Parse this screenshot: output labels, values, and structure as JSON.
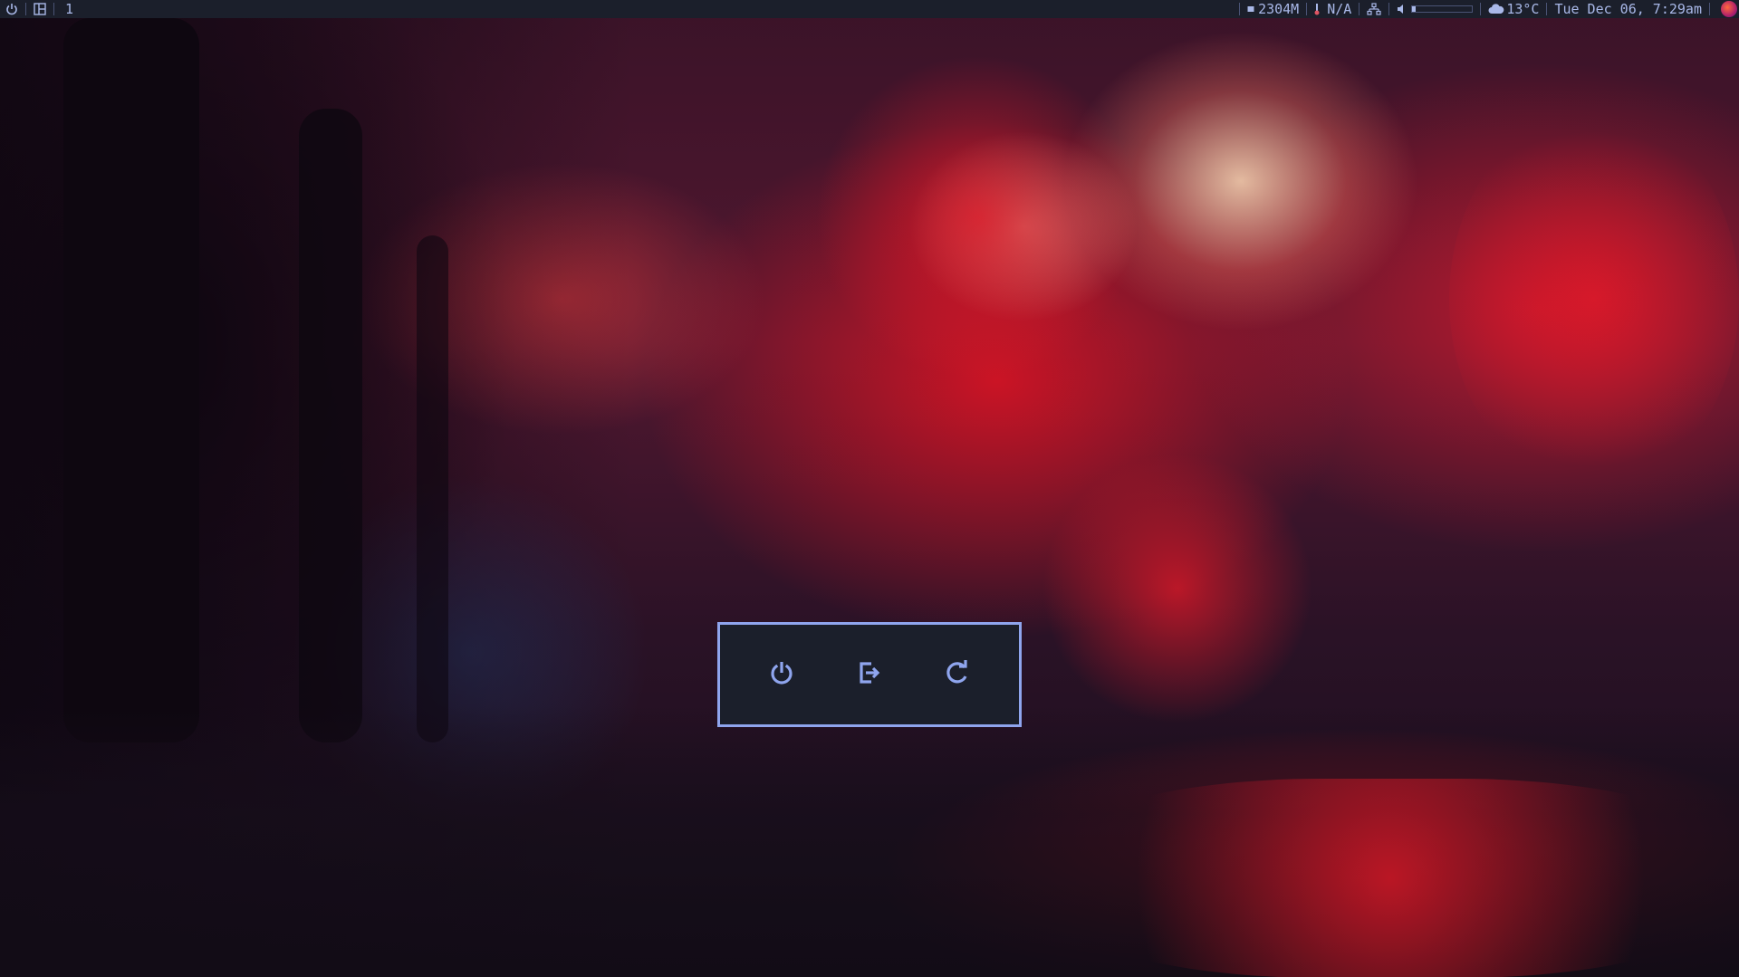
{
  "topbar": {
    "left": {
      "power_icon": "power-icon",
      "layout_icon": "layout-icon",
      "workspace": "1"
    },
    "right": {
      "memory_icon": "memory-icon",
      "memory": "2304M",
      "thermometer_icon": "thermometer-icon",
      "temperature_sensor": "N/A",
      "network_icon": "network-icon",
      "volume_icon": "volume-icon",
      "volume_level": 0.05,
      "weather_icon": "cloud-icon",
      "weather": "13°C",
      "datetime": "Tue Dec 06, 7:29am"
    }
  },
  "power_menu": {
    "buttons": [
      {
        "icon": "power-icon",
        "action": "shutdown"
      },
      {
        "icon": "logout-icon",
        "action": "logout"
      },
      {
        "icon": "reboot-icon",
        "action": "reboot"
      }
    ]
  },
  "colors": {
    "bar_bg": "#1b1f2b",
    "accent": "#8fa5ee",
    "text": "#a9b8e8"
  }
}
